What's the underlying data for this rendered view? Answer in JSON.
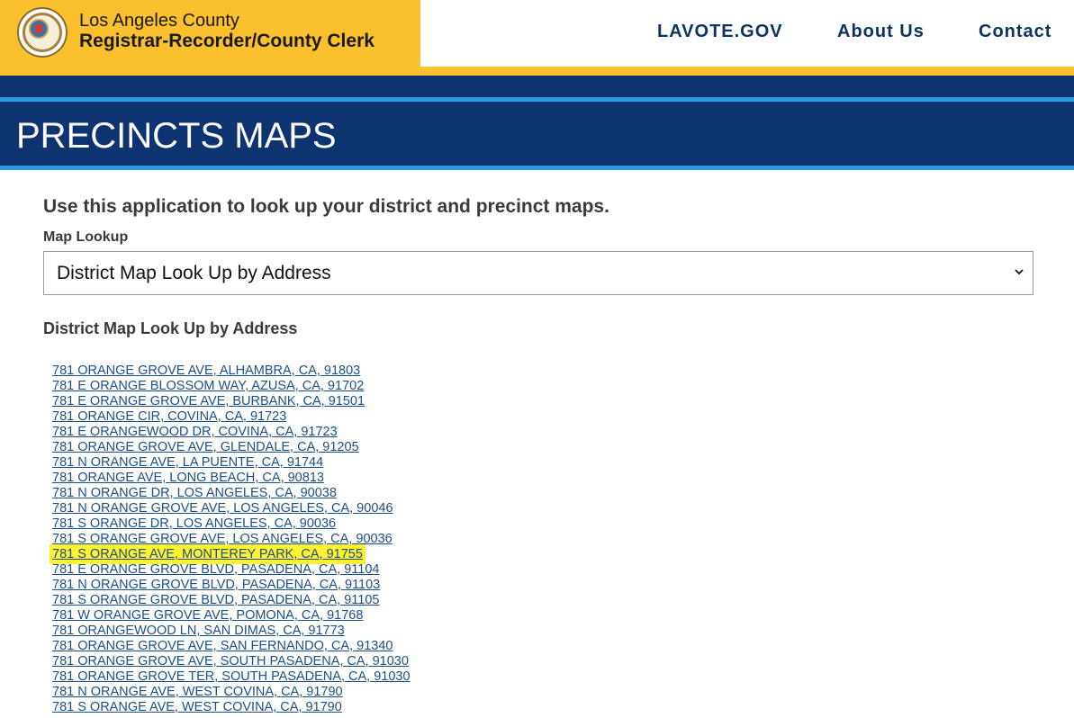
{
  "header": {
    "org_line1": "Los Angeles County",
    "org_line2": "Registrar-Recorder/County Clerk",
    "seal_icon": "county-seal-icon",
    "nav": [
      "LAVOTE.GOV",
      "About Us",
      "Contact"
    ],
    "colors": {
      "gold": "#fbc02d",
      "navy": "#0d3370",
      "light_blue": "#2a9be0",
      "link": "#1c4f86",
      "highlight": "#fff230"
    }
  },
  "page": {
    "title": "PRECINCTS MAPS",
    "intro": "Use this application to look up your district and precinct maps.",
    "map_lookup_label": "Map Lookup",
    "map_lookup_selected": "District Map Look Up by Address",
    "section_heading": "District Map Look Up by Address"
  },
  "results": [
    "781 ORANGE GROVE AVE, ALHAMBRA, CA, 91803",
    "781 E ORANGE BLOSSOM WAY, AZUSA, CA, 91702",
    "781 E ORANGE GROVE AVE, BURBANK, CA, 91501",
    "781 ORANGE CIR, COVINA, CA, 91723",
    "781 E ORANGEWOOD DR, COVINA, CA, 91723",
    "781 ORANGE GROVE AVE, GLENDALE, CA, 91205",
    "781 N ORANGE AVE, LA PUENTE, CA, 91744",
    "781 ORANGE AVE, LONG BEACH, CA, 90813",
    "781 N ORANGE DR, LOS ANGELES, CA, 90038",
    "781 N ORANGE GROVE AVE, LOS ANGELES, CA, 90046",
    "781 S ORANGE DR, LOS ANGELES, CA, 90036",
    "781 S ORANGE GROVE AVE, LOS ANGELES, CA, 90036",
    "781 S ORANGE AVE, MONTEREY PARK, CA, 91755",
    "781 E ORANGE GROVE BLVD, PASADENA, CA, 91104",
    "781 N ORANGE GROVE BLVD, PASADENA, CA, 91103",
    "781 S ORANGE GROVE BLVD, PASADENA, CA, 91105",
    "781 W ORANGE GROVE AVE, POMONA, CA, 91768",
    "781 ORANGEWOOD LN, SAN DIMAS, CA, 91773",
    "781 ORANGE GROVE AVE, SAN FERNANDO, CA, 91340",
    "781 ORANGE GROVE AVE, SOUTH PASADENA, CA, 91030",
    "781 ORANGE GROVE TER, SOUTH PASADENA, CA, 91030",
    "781 N ORANGE AVE, WEST COVINA, CA, 91790",
    "781 S ORANGE AVE, WEST COVINA, CA, 91790"
  ],
  "highlighted_result": "781 S ORANGE AVE, MONTEREY PARK, CA, 91755"
}
